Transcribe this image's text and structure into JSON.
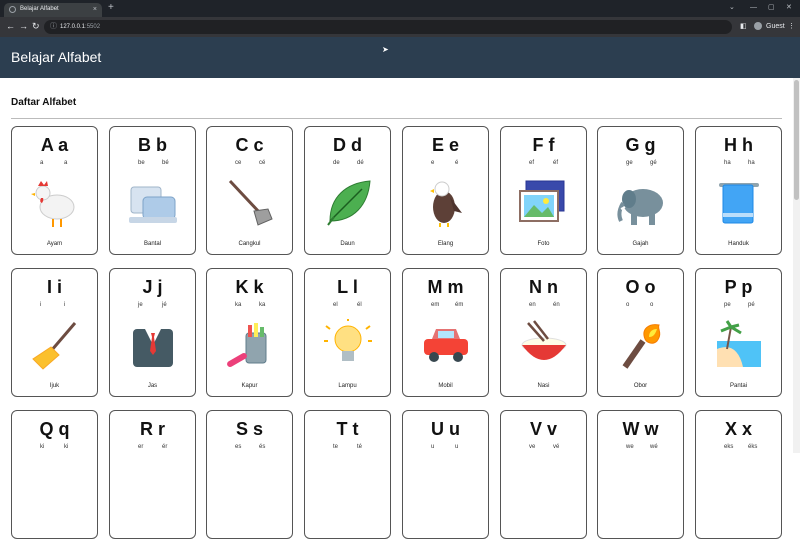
{
  "browser": {
    "tab_title": "Belajar Alfabet",
    "tab_close": "×",
    "new_tab": "+",
    "url_host": "127.0.0.1",
    "url_port": ":5502",
    "profile_label": "Guest",
    "icons": [
      "back-icon",
      "forward-icon",
      "reload-icon",
      "info-icon",
      "sidebar-icon",
      "profile-icon",
      "menu-icon"
    ]
  },
  "app": {
    "header_title": "Belajar Alfabet",
    "section_title": "Daftar Alfabet",
    "header_color": "#2c3e50"
  },
  "cards": [
    {
      "upper": "A a",
      "pu": "a",
      "pl": "a",
      "word": "Ayam",
      "icon": "chicken"
    },
    {
      "upper": "B b",
      "pu": "be",
      "pl": "bé",
      "word": "Bantal",
      "icon": "pillow"
    },
    {
      "upper": "C c",
      "pu": "ce",
      "pl": "cé",
      "word": "Cangkul",
      "icon": "hoe"
    },
    {
      "upper": "D d",
      "pu": "de",
      "pl": "dé",
      "word": "Daun",
      "icon": "leaf"
    },
    {
      "upper": "E e",
      "pu": "e",
      "pl": "é",
      "word": "Elang",
      "icon": "eagle"
    },
    {
      "upper": "F f",
      "pu": "ef",
      "pl": "éf",
      "word": "Foto",
      "icon": "photo"
    },
    {
      "upper": "G g",
      "pu": "ge",
      "pl": "gé",
      "word": "Gajah",
      "icon": "elephant"
    },
    {
      "upper": "H h",
      "pu": "ha",
      "pl": "ha",
      "word": "Handuk",
      "icon": "towel"
    },
    {
      "upper": "I i",
      "pu": "i",
      "pl": "i",
      "word": "Ijuk",
      "icon": "broom"
    },
    {
      "upper": "J j",
      "pu": "je",
      "pl": "jé",
      "word": "Jas",
      "icon": "suit"
    },
    {
      "upper": "K k",
      "pu": "ka",
      "pl": "ka",
      "word": "Kapur",
      "icon": "chalk"
    },
    {
      "upper": "L l",
      "pu": "el",
      "pl": "él",
      "word": "Lampu",
      "icon": "bulb"
    },
    {
      "upper": "M m",
      "pu": "em",
      "pl": "ém",
      "word": "Mobil",
      "icon": "car"
    },
    {
      "upper": "N n",
      "pu": "en",
      "pl": "én",
      "word": "Nasi",
      "icon": "rice"
    },
    {
      "upper": "O o",
      "pu": "o",
      "pl": "o",
      "word": "Obor",
      "icon": "torch"
    },
    {
      "upper": "P p",
      "pu": "pe",
      "pl": "pé",
      "word": "Pantai",
      "icon": "beach"
    },
    {
      "upper": "Q q",
      "pu": "ki",
      "pl": "ki",
      "word": "",
      "icon": ""
    },
    {
      "upper": "R r",
      "pu": "er",
      "pl": "ér",
      "word": "",
      "icon": ""
    },
    {
      "upper": "S s",
      "pu": "es",
      "pl": "és",
      "word": "",
      "icon": ""
    },
    {
      "upper": "T t",
      "pu": "te",
      "pl": "té",
      "word": "",
      "icon": ""
    },
    {
      "upper": "U u",
      "pu": "u",
      "pl": "u",
      "word": "",
      "icon": ""
    },
    {
      "upper": "V v",
      "pu": "ve",
      "pl": "vé",
      "word": "",
      "icon": ""
    },
    {
      "upper": "W w",
      "pu": "we",
      "pl": "wé",
      "word": "",
      "icon": ""
    },
    {
      "upper": "X x",
      "pu": "eks",
      "pl": "éks",
      "word": "",
      "icon": ""
    }
  ]
}
